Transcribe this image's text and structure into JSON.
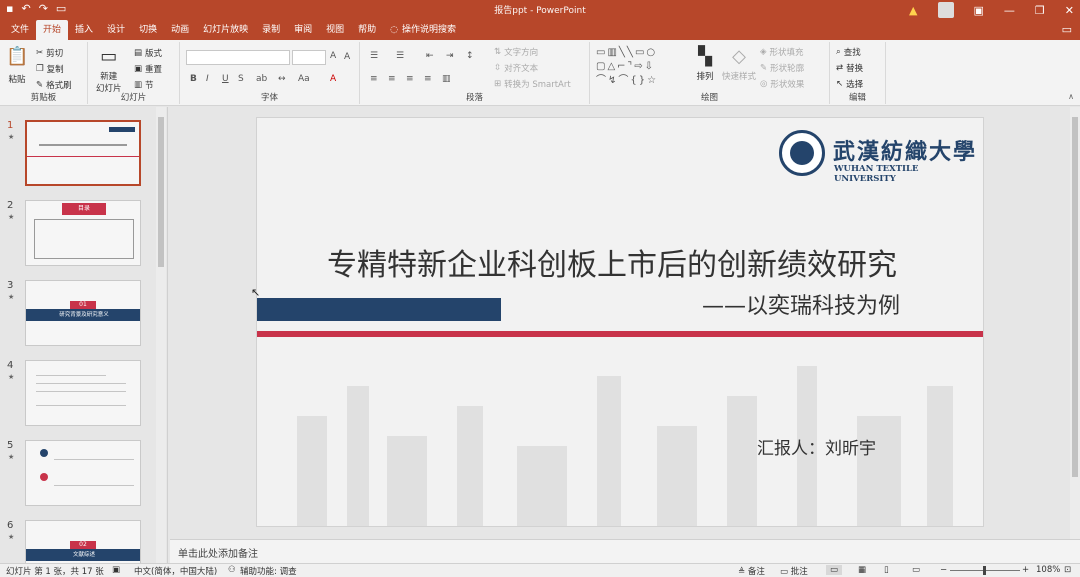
{
  "titlebar": {
    "doc_title": "报告ppt - PowerPoint",
    "qa_icons": [
      "save-icon",
      "undo-icon",
      "redo-icon",
      "slideshow-icon"
    ],
    "win_controls": [
      "ribbon-display-icon",
      "minimize-icon",
      "restore-icon",
      "close-icon"
    ]
  },
  "tabs": [
    {
      "label": "文件"
    },
    {
      "label": "开始",
      "active": true
    },
    {
      "label": "插入"
    },
    {
      "label": "设计"
    },
    {
      "label": "切换"
    },
    {
      "label": "动画"
    },
    {
      "label": "幻灯片放映"
    },
    {
      "label": "录制"
    },
    {
      "label": "审阅"
    },
    {
      "label": "视图"
    },
    {
      "label": "帮助"
    }
  ],
  "tell_me": "操作说明搜索",
  "ribbon": {
    "clipboard": {
      "label": "剪贴板",
      "paste": "粘贴",
      "cut": "剪切",
      "copy": "复制",
      "format_painter": "格式刷"
    },
    "slides": {
      "label": "幻灯片",
      "new_slide": "新建",
      "new_slide_2": "幻灯片",
      "layout": "版式",
      "reset": "重置",
      "section": "节"
    },
    "font": {
      "label": "字体"
    },
    "paragraph": {
      "label": "段落",
      "text_direction": "文字方向",
      "align_text": "对齐文本",
      "smartart": "转换为 SmartArt"
    },
    "drawing": {
      "label": "绘图",
      "arrange": "排列",
      "quick_styles": "快速样式",
      "shape_fill": "形状填充",
      "shape_outline": "形状轮廓",
      "shape_effects": "形状效果"
    },
    "editing": {
      "label": "编辑",
      "find": "查找",
      "replace": "替换",
      "select": "选择"
    }
  },
  "thumbnails": [
    {
      "num": "1",
      "selected": true,
      "kind": "title",
      "caption": "",
      "sub": ""
    },
    {
      "num": "2",
      "selected": false,
      "kind": "toc",
      "caption": "目录",
      "sub": ""
    },
    {
      "num": "3",
      "selected": false,
      "kind": "section",
      "caption": "01",
      "sub": "研究背景及研究意义"
    },
    {
      "num": "4",
      "selected": false,
      "kind": "text",
      "caption": "",
      "sub": ""
    },
    {
      "num": "5",
      "selected": false,
      "kind": "text",
      "caption": "",
      "sub": ""
    },
    {
      "num": "6",
      "selected": false,
      "kind": "section",
      "caption": "02",
      "sub": "文献综述"
    }
  ],
  "slide": {
    "logo_cn": "武漢紡織大學",
    "logo_en": "WUHAN TEXTILE UNIVERSITY",
    "title": "专精特新企业科创板上市后的创新绩效研究",
    "subtitle": "——以奕瑞科技为例",
    "reporter": "汇报人：刘昕宇",
    "colors": {
      "navy": "#24446b",
      "red": "#c8334a",
      "ribbon": "#b7472a"
    }
  },
  "notes_placeholder": "单击此处添加备注",
  "status": {
    "slide_info": "幻灯片 第 1 张，共 17 张",
    "language": "中文(简体，中国大陆)",
    "accessibility": "辅助功能: 调查",
    "notes": "备注",
    "comments": "批注",
    "zoom": "108%"
  }
}
